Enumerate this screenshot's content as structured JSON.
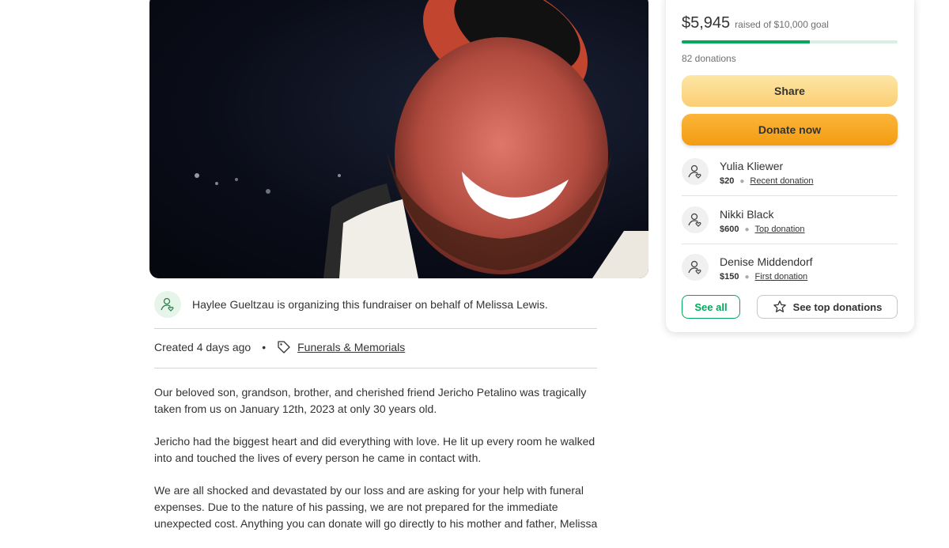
{
  "organizer": {
    "text": "Haylee Gueltzau is organizing this fundraiser on behalf of Melissa Lewis."
  },
  "meta": {
    "created": "Created 4 days ago",
    "separator": "•",
    "category": "Funerals & Memorials"
  },
  "story": {
    "paragraphs": [
      "Our beloved son, grandson, brother, and cherished friend Jericho Petalino was tragically taken from us on January 12th, 2023 at only 30 years old.",
      "Jericho had the biggest heart and did everything with love. He lit up every room he walked into and touched the lives of every person he came in contact with.",
      "We are all shocked and devastated by our loss and are asking for your help with funeral expenses. Due to the nature of his passing, we are not prepared for the immediate unexpected cost. Anything you can donate will go directly to his mother and father, Melissa"
    ]
  },
  "donation_card": {
    "raised": "$5,945",
    "goal_text": "raised of $10,000 goal",
    "progress_fraction": 0.5945,
    "donations_count": "82 donations",
    "share_label": "Share",
    "donate_label": "Donate now",
    "donors": [
      {
        "name": "Yulia Kliewer",
        "amount": "$20",
        "tag": "Recent donation"
      },
      {
        "name": "Nikki Black",
        "amount": "$600",
        "tag": "Top donation"
      },
      {
        "name": "Denise Middendorf",
        "amount": "$150",
        "tag": "First donation"
      }
    ],
    "see_all_label": "See all",
    "see_top_label": "See top donations"
  },
  "colors": {
    "accent_green": "#02a95c",
    "progress_track": "#d9efe3",
    "donate_orange": "#f39c12",
    "share_yellow": "#fbce74"
  },
  "icons": {
    "organizer_avatar": "user-heart-icon",
    "category": "tag-icon",
    "donor_avatar": "user-heart-icon",
    "top_donations": "star-icon"
  }
}
